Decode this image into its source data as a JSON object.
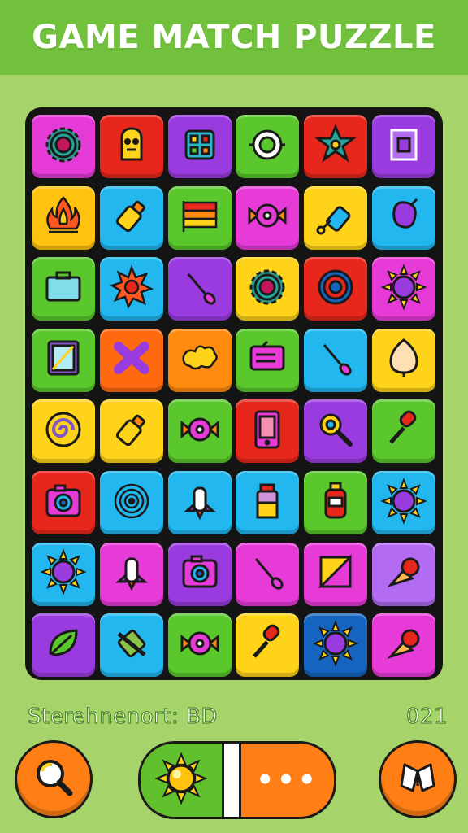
{
  "header": {
    "title": "GAME MATCH PUZZLE"
  },
  "footer": {
    "status_label": "Sterehnenort: BD",
    "score": "021",
    "more_label": "•••"
  },
  "colors": {
    "header": "#72c13c",
    "background": "#a6d46a",
    "board": "#141414",
    "button": "#ff7f16"
  },
  "grid": [
    [
      {
        "color": "#e73bd8",
        "icon": "gear-icon"
      },
      {
        "color": "#e8271c",
        "icon": "face-icon"
      },
      {
        "color": "#9a3be0",
        "icon": "dice-icon"
      },
      {
        "color": "#5ac82c",
        "icon": "ring-icon"
      },
      {
        "color": "#e8271c",
        "icon": "star-icon"
      },
      {
        "color": "#9a3be0",
        "icon": "frame-icon"
      }
    ],
    [
      {
        "color": "#ffc20e",
        "icon": "fire-icon"
      },
      {
        "color": "#22b8ef",
        "icon": "bottle-icon"
      },
      {
        "color": "#5ac82c",
        "icon": "flag-icon"
      },
      {
        "color": "#e73bd8",
        "icon": "candy-icon"
      },
      {
        "color": "#ffd31a",
        "icon": "key-icon"
      },
      {
        "color": "#22b8ef",
        "icon": "blob-icon"
      }
    ],
    [
      {
        "color": "#5ac82c",
        "icon": "briefcase-icon"
      },
      {
        "color": "#22b8ef",
        "icon": "spike-ball-icon"
      },
      {
        "color": "#9a3be0",
        "icon": "spoon-icon"
      },
      {
        "color": "#ffd31a",
        "icon": "gear-icon"
      },
      {
        "color": "#e8271c",
        "icon": "donut-icon"
      },
      {
        "color": "#e73bd8",
        "icon": "sun-icon"
      }
    ],
    [
      {
        "color": "#5ac82c",
        "icon": "tablet-icon"
      },
      {
        "color": "#ff6a10",
        "icon": "cross-icon"
      },
      {
        "color": "#ff8a10",
        "icon": "splat-icon"
      },
      {
        "color": "#5ac82c",
        "icon": "radio-icon"
      },
      {
        "color": "#22b8ef",
        "icon": "spoon-icon"
      },
      {
        "color": "#ffd31a",
        "icon": "shell-icon"
      }
    ],
    [
      {
        "color": "#ffd31a",
        "icon": "swirl-icon"
      },
      {
        "color": "#ffd31a",
        "icon": "bottle-icon"
      },
      {
        "color": "#5ac82c",
        "icon": "candy-icon"
      },
      {
        "color": "#e8271c",
        "icon": "phone-icon"
      },
      {
        "color": "#9a3be0",
        "icon": "magnifier-icon"
      },
      {
        "color": "#5ac82c",
        "icon": "dropper-icon"
      }
    ],
    [
      {
        "color": "#e8271c",
        "icon": "camera-icon"
      },
      {
        "color": "#22b8ef",
        "icon": "target-icon"
      },
      {
        "color": "#22b8ef",
        "icon": "rocket-icon"
      },
      {
        "color": "#22b8ef",
        "icon": "jar-icon"
      },
      {
        "color": "#5ac82c",
        "icon": "potion-icon"
      },
      {
        "color": "#22b8ef",
        "icon": "sun-icon"
      }
    ],
    [
      {
        "color": "#22b8ef",
        "icon": "sun-icon"
      },
      {
        "color": "#e73bd8",
        "icon": "rocket-icon"
      },
      {
        "color": "#9a3be0",
        "icon": "camera-icon"
      },
      {
        "color": "#e73bd8",
        "icon": "spoon-icon"
      },
      {
        "color": "#e73bd8",
        "icon": "note-icon"
      },
      {
        "color": "#b36bf2",
        "icon": "cone-icon"
      }
    ],
    [
      {
        "color": "#9a3be0",
        "icon": "leaf-icon"
      },
      {
        "color": "#22b8ef",
        "icon": "battery-icon"
      },
      {
        "color": "#5ac82c",
        "icon": "candy-icon"
      },
      {
        "color": "#ffd31a",
        "icon": "dropper-icon"
      },
      {
        "color": "#1565c0",
        "icon": "sun-icon"
      },
      {
        "color": "#e73bd8",
        "icon": "cone-icon"
      }
    ]
  ]
}
